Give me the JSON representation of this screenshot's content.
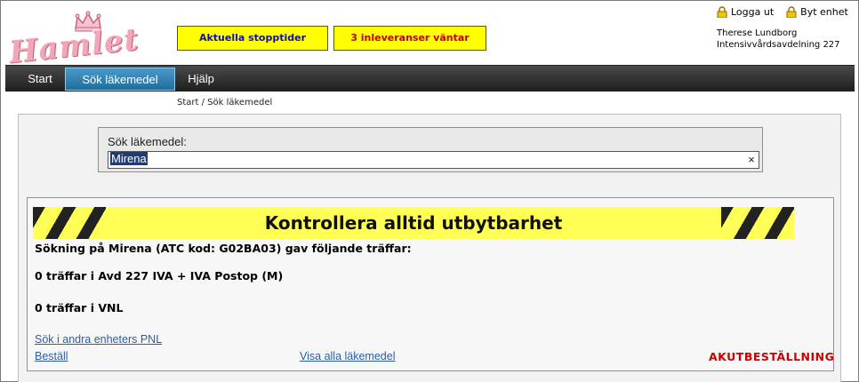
{
  "header": {
    "logo_text": "Hamlet",
    "notices": [
      {
        "label": "Aktuella stopptider"
      },
      {
        "label": "3 inleveranser väntar"
      }
    ],
    "top_links": {
      "logout": "Logga ut",
      "switch_unit": "Byt enhet"
    },
    "user": {
      "name": "Therese Lundborg",
      "unit": "Intensivvårdsavdelning 227"
    }
  },
  "nav": {
    "items": [
      {
        "label": "Start"
      },
      {
        "label": "Sök läkemedel"
      },
      {
        "label": "Hjälp"
      }
    ],
    "active": "Sök läkemedel"
  },
  "breadcrumb": "Start / Sök läkemedel",
  "search": {
    "label": "Sök läkemedel:",
    "value": "Mirena",
    "clear_symbol": "×"
  },
  "results": {
    "warning": "Kontrollera alltid utbytbarhet",
    "summary": "Sökning på Mirena (ATC kod: G02BA03) gav följande träffar:",
    "hits_unit": "0 träffar i Avd 227 IVA + IVA Postop (M)",
    "hits_vnl": "0 träffar i VNL",
    "links": {
      "other_units": "Sök i andra enheters PNL",
      "order": "Beställ",
      "show_all": "Visa alla läkemedel",
      "acute": "AKUTBESTÄLLNING"
    }
  },
  "colors": {
    "notice_bg": "#ffff00",
    "nav_active": "#2e86be",
    "acute": "#d00000",
    "link": "#2a5ea8"
  }
}
